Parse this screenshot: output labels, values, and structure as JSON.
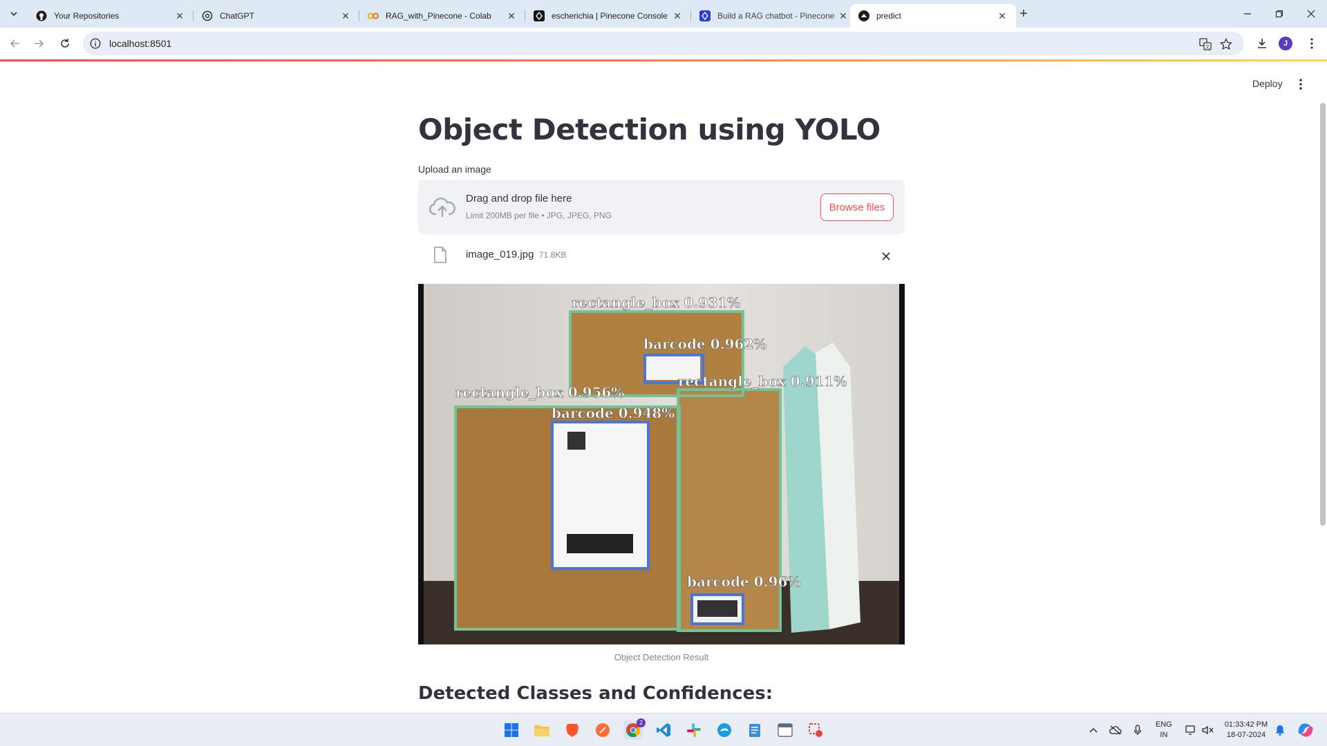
{
  "browser": {
    "tabs": [
      {
        "title": "Your Repositories",
        "icon": "github-icon"
      },
      {
        "title": "ChatGPT",
        "icon": "chatgpt-icon"
      },
      {
        "title": "RAG_with_Pinecone - Colab",
        "icon": "colab-icon"
      },
      {
        "title": "escherichia | Pinecone Console",
        "icon": "pinecone-icon"
      },
      {
        "title": "Build a RAG chatbot - Pinecone",
        "icon": "pinecone-docs-icon"
      },
      {
        "title": "predict",
        "icon": "streamlit-icon",
        "active": true
      }
    ],
    "url": "localhost:8501",
    "avatar_initial": "J"
  },
  "app": {
    "deploy_label": "Deploy",
    "title": "Object Detection using YOLO",
    "uploader": {
      "label": "Upload an image",
      "drop_text": "Drag and drop file here",
      "limit_text": "Limit 200MB per file • JPG, JPEG, PNG",
      "browse_label": "Browse files"
    },
    "file": {
      "name": "image_019.jpg",
      "size": "71.8KB"
    },
    "detections": [
      {
        "label": "rectangle_box 0.931%"
      },
      {
        "label": "barcode 0.962%"
      },
      {
        "label": "rectangle_box 0.911%"
      },
      {
        "label": "rectangle_box 0.956%"
      },
      {
        "label": "barcode 0.948%"
      },
      {
        "label": "barcode 0.96%"
      }
    ],
    "image_caption": "Object Detection Result",
    "section_title": "Detected Classes and Confidences:",
    "colors": {
      "accent": "#ff4b4b",
      "box_green": "#6fbf8f",
      "box_blue": "#4a74d8",
      "text": "#31333f"
    }
  },
  "taskbar": {
    "language": [
      "ENG",
      "IN"
    ],
    "time": "01:33:42 PM",
    "date": "18-07-2024",
    "chrome_badge": "2"
  }
}
